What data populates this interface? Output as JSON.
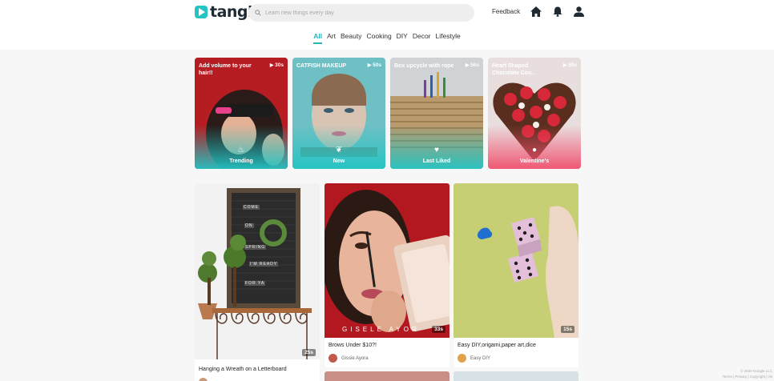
{
  "app": {
    "name": "tangi",
    "brand_color": "#23c4c4"
  },
  "search": {
    "placeholder": "Learn new things every day"
  },
  "header": {
    "feedback_label": "Feedback",
    "icons": [
      "home-icon",
      "bell-icon",
      "user-icon"
    ]
  },
  "categories": [
    "All",
    "Art",
    "Beauty",
    "Cooking",
    "DIY",
    "Decor",
    "Lifestyle"
  ],
  "active_category": "All",
  "collections": [
    {
      "title": "Add volume to your hair!!",
      "duration": "30s",
      "label": "Trending",
      "icon": "flame-icon"
    },
    {
      "title": "CATFISH MAKEUP",
      "duration": "50s",
      "label": "New",
      "icon": "sprout-icon"
    },
    {
      "title": "Box upcycle with rope",
      "duration": "56s",
      "label": "Last Liked",
      "icon": "heart-icon"
    },
    {
      "title": "Heart Shaped Chocolate Cov...",
      "duration": "59s",
      "label": "Valentine's",
      "icon": "chocolate-icon"
    }
  ],
  "cards": [
    {
      "title": "Hanging a Wreath on a Letterboard",
      "duration": "25s",
      "author": ""
    },
    {
      "title": "Brows Under $10?!",
      "duration": "33s",
      "author": "Gissie Ayora"
    },
    {
      "title": "Easy DIY,origami,paper art,dice",
      "duration": "15s",
      "author": "Easy DIY"
    }
  ],
  "video_overlay_text": "GISELE AYOR",
  "letterboard_words": [
    "COME",
    "ON",
    "SPRING",
    "I'M READY",
    "FOR YA"
  ],
  "footer": {
    "copyright": "© 2020 Google LLC",
    "links": "Terms | Privacy | Copyright | Ab"
  }
}
